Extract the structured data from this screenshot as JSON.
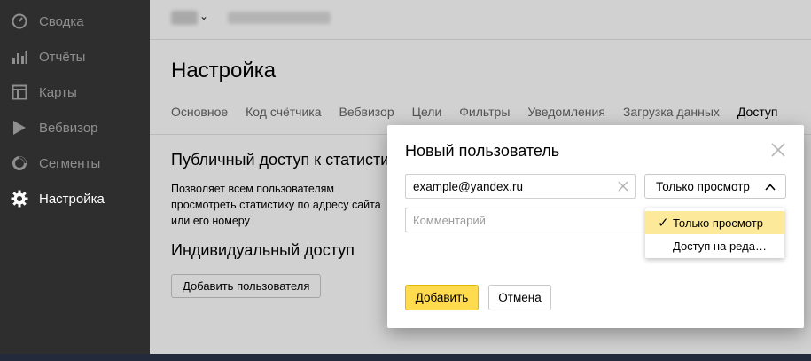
{
  "sidebar": {
    "items": [
      {
        "label": "Сводка",
        "icon": "dashboard-icon"
      },
      {
        "label": "Отчёты",
        "icon": "reports-icon"
      },
      {
        "label": "Карты",
        "icon": "maps-icon"
      },
      {
        "label": "Вебвизор",
        "icon": "play-icon"
      },
      {
        "label": "Сегменты",
        "icon": "segments-icon"
      },
      {
        "label": "Настройка",
        "icon": "gear-icon",
        "active": true
      }
    ]
  },
  "header": {
    "caret": "⌄"
  },
  "page": {
    "title": "Настройка",
    "tabs": [
      "Основное",
      "Код счётчика",
      "Вебвизор",
      "Цели",
      "Фильтры",
      "Уведомления",
      "Загрузка данных",
      "Доступ"
    ],
    "active_tab": "Доступ",
    "public_access": {
      "title": "Публичный доступ к статистике",
      "text": "Позволяет всем пользователям просмотреть статистику по адресу сайта или его номеру"
    },
    "individual_access": {
      "title": "Индивидуальный доступ",
      "add_user_label": "Добавить пользователя"
    }
  },
  "modal": {
    "title": "Новый пользователь",
    "email_value": "example@yandex.ru",
    "comment_placeholder": "Комментарий",
    "access_select_value": "Только просмотр",
    "access_options": [
      {
        "label": "Только просмотр",
        "selected": true
      },
      {
        "label": "Доступ на реда…",
        "selected": false
      }
    ],
    "check_mark": "✓",
    "add_label": "Добавить",
    "cancel_label": "Отмена"
  },
  "colors": {
    "sidebar_bg": "#2e2e2e",
    "accent_yellow": "#ffdb4d",
    "selected_option_bg": "#fde99a"
  }
}
